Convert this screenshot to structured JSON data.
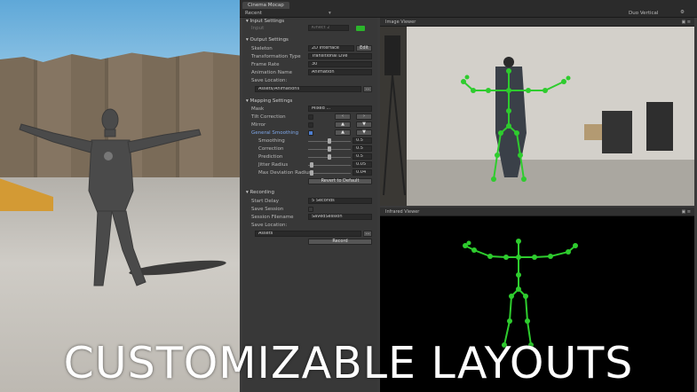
{
  "window": {
    "tab": "Cinema Mocap",
    "layout_dropdown": "Recent",
    "layout_right": "Duo Vertical"
  },
  "input": {
    "header": "Input Settings",
    "input_label": "Input",
    "input_value": "Kinect 2",
    "record_icon": "record-icon"
  },
  "output": {
    "header": "Output Settings",
    "skeleton_label": "Skeleton",
    "skeleton_value": "2D Interface",
    "skeleton_btn": "Edit",
    "transform_label": "Transformation Type",
    "transform_value": "Transitional Live",
    "framerate_label": "Frame Rate",
    "framerate_value": "30",
    "animname_label": "Animation Name",
    "animname_value": "Animation",
    "saveloc_label": "Save Location:",
    "saveloc_value": "Assets/Animations",
    "saveloc_btn": "..."
  },
  "mapping": {
    "header": "Mapping Settings",
    "mask_label": "Mask",
    "mask_value": "Mixed ...",
    "tilt_label": "Tilt Correction",
    "mirror_label": "Mirror",
    "smoothing_label": "General Smoothing",
    "smoothing_sub": "Smoothing",
    "smoothing_val": "0.5",
    "correction_label": "Correction",
    "correction_val": "0.5",
    "prediction_label": "Prediction",
    "prediction_val": "0.5",
    "jitter_label": "Jitter Radius",
    "jitter_val": "0.05",
    "maxdev_label": "Max Deviation Radius",
    "maxdev_val": "0.04",
    "revert_btn": "Revert to Default"
  },
  "recording": {
    "header": "Recording",
    "delay_label": "Start Delay",
    "delay_value": "5 Seconds",
    "save_session_label": "Save Session",
    "filename_label": "Session Filename",
    "filename_value": "SavedSession",
    "saveloc_label": "Save Location:",
    "saveloc_value": "Assets",
    "saveloc_btn": "...",
    "record_btn": "Record"
  },
  "views": {
    "image": "Image Viewer",
    "infrared": "Infrared Viewer"
  },
  "caption": "CUSTOMIZABLE LAYOUTS"
}
